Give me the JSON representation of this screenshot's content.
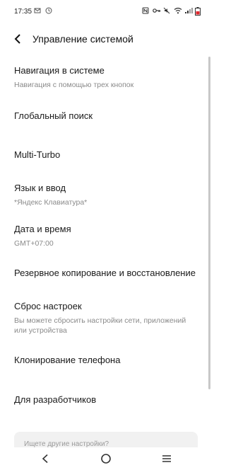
{
  "status_bar": {
    "time": "17:35",
    "left_icons": [
      "mail-icon",
      "clock-icon"
    ],
    "right_icons": [
      "nfc-icon",
      "key-icon",
      "mute-icon",
      "wifi-icon",
      "signal-icon",
      "battery-icon"
    ]
  },
  "header": {
    "title": "Управление системой",
    "back_icon": "back-arrow-icon"
  },
  "items": [
    {
      "title": "Навигация в системе",
      "subtitle": "Навигация с помощью трех кнопок"
    },
    {
      "title": "Глобальный поиск",
      "subtitle": ""
    },
    {
      "title": "Multi-Turbo",
      "subtitle": ""
    },
    {
      "title": "Язык и ввод",
      "subtitle": "*Яндекс Клавиатура*"
    },
    {
      "title": "Дата и время",
      "subtitle": "GMT+07:00"
    },
    {
      "title": "Резервное копирование и восстановление",
      "subtitle": ""
    },
    {
      "title": "Сброс настроек",
      "subtitle": "Вы можете сбросить настройки сети, приложений или устройства"
    },
    {
      "title": "Клонирование телефона",
      "subtitle": ""
    },
    {
      "title": "Для разработчиков",
      "subtitle": ""
    }
  ],
  "search": {
    "placeholder": "Ищете другие настройки?"
  },
  "nav_bar": {
    "icons": [
      "back-icon",
      "home-icon",
      "menu-icon"
    ]
  }
}
